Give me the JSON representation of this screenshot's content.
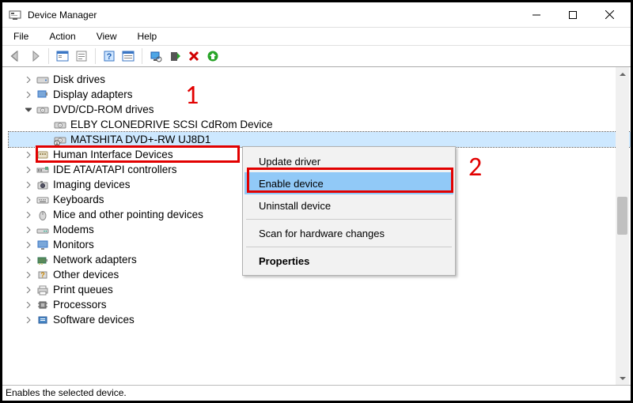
{
  "window": {
    "title": "Device Manager"
  },
  "menus": {
    "file": "File",
    "action": "Action",
    "view": "View",
    "help": "Help"
  },
  "tree": {
    "disk_drives": "Disk drives",
    "display_adapters": "Display adapters",
    "dvd_cdrom": "DVD/CD-ROM drives",
    "dvd_cdrom_children": {
      "elby": "ELBY CLONEDRIVE SCSI CdRom Device",
      "matshita": "MATSHITA DVD+-RW UJ8D1"
    },
    "hid": "Human Interface Devices",
    "ide": "IDE ATA/ATAPI controllers",
    "imaging": "Imaging devices",
    "keyboards": "Keyboards",
    "mice": "Mice and other pointing devices",
    "modems": "Modems",
    "monitors": "Monitors",
    "network": "Network adapters",
    "other": "Other devices",
    "print_queues": "Print queues",
    "processors": "Processors",
    "software": "Software devices"
  },
  "context_menu": {
    "update": "Update driver",
    "enable": "Enable device",
    "uninstall": "Uninstall device",
    "scan": "Scan for hardware changes",
    "properties": "Properties"
  },
  "statusbar": {
    "text": "Enables the selected device."
  },
  "annotations": {
    "one": "1",
    "two": "2"
  }
}
